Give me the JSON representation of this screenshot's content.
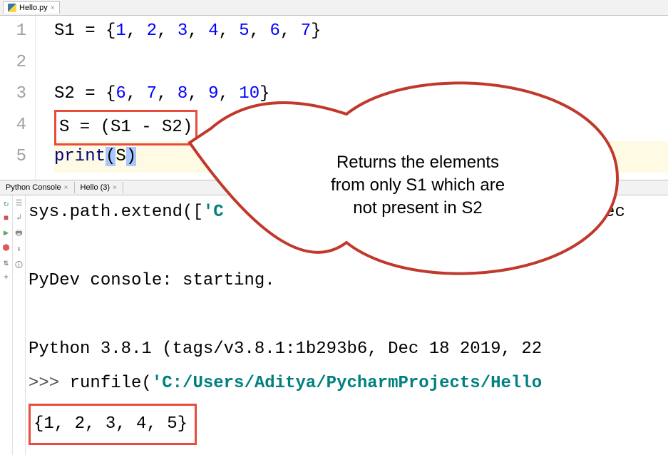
{
  "file_tab": {
    "name": "Hello.py"
  },
  "gutter": [
    "1",
    "2",
    "3",
    "4",
    "5"
  ],
  "code": {
    "l1": {
      "pre": "S1 = {",
      "n1": "1",
      "c1": ", ",
      "n2": "2",
      "c2": ", ",
      "n3": "3",
      "c3": ", ",
      "n4": "4",
      "c4": ", ",
      "n5": "5",
      "c5": ", ",
      "n6": "6",
      "c6": ", ",
      "n7": "7",
      "post": "}"
    },
    "l3": {
      "pre": "S2 = {",
      "n1": "6",
      "c1": ", ",
      "n2": "7",
      "c2": ", ",
      "n3": "8",
      "c3": ", ",
      "n4": "9",
      "c4": ", ",
      "n5": "10",
      "post": "}"
    },
    "l4": "S = (S1 - S2)",
    "l5": {
      "print": "print",
      "open": "(",
      "arg": "S",
      "close": ")"
    }
  },
  "console_tabs": {
    "t1": "Python Console",
    "t2": "Hello (3)"
  },
  "console": {
    "l1a": "sys.path.extend([",
    "l1b": "'C",
    "l1z": "jec",
    "l3": "PyDev console: starting.",
    "l5": "Python 3.8.1 (tags/v3.8.1:1b293b6, Dec 18 2019, 22",
    "l6p": ">>> ",
    "l6a": "runfile(",
    "l6b": "'C:/Users/Aditya/PycharmProjects/Hello",
    "l7": "{1, 2, 3, 4, 5}"
  },
  "callout": {
    "line1": "Returns the elements",
    "line2": "from only S1  which are",
    "line3": "not present in S2"
  }
}
